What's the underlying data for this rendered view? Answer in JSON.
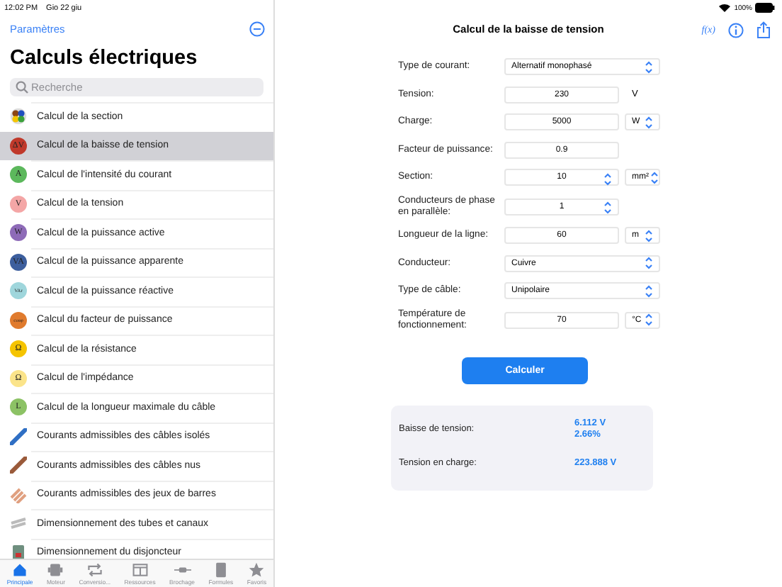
{
  "status_bar": {
    "time": "12:02 PM",
    "date": "Gio 22 giu",
    "battery_text": "100%"
  },
  "sidebar": {
    "back_link": "Paramètres",
    "title": "Calculs électriques",
    "search": {
      "placeholder": "Recherche"
    },
    "items": [
      {
        "label": "Calcul de la section",
        "kind": "pie",
        "selected": false
      },
      {
        "label": "Calcul de la baisse de tension",
        "kind": "circle",
        "glyph": "ΔV",
        "color": "#c0392b",
        "selected": true
      },
      {
        "label": "Calcul de l'intensité du courant",
        "kind": "circle",
        "glyph": "A",
        "color": "#5cb85c",
        "selected": false
      },
      {
        "label": "Calcul de la tension",
        "kind": "circle",
        "glyph": "V",
        "color": "#f4a6a6",
        "selected": false
      },
      {
        "label": "Calcul de la puissance active",
        "kind": "circle",
        "glyph": "W",
        "color": "#8e6bb8",
        "selected": false
      },
      {
        "label": "Calcul de la puissance apparente",
        "kind": "circle",
        "glyph": "VA",
        "color": "#3d5f9e",
        "selected": false
      },
      {
        "label": "Calcul de la puissance réactive",
        "kind": "circle",
        "glyph": "VAr",
        "color": "#9fd6dc",
        "selected": false
      },
      {
        "label": "Calcul du facteur de puissance",
        "kind": "circle",
        "glyph": "cosφ",
        "color": "#e07b2e",
        "selected": false
      },
      {
        "label": "Calcul de la résistance",
        "kind": "circle",
        "glyph": "Ω",
        "color": "#f5c400",
        "selected": false
      },
      {
        "label": "Calcul de l'impédance",
        "kind": "circle",
        "glyph": "Ω",
        "color": "#fbe48a",
        "selected": false
      },
      {
        "label": "Calcul de la longueur maximale du câble",
        "kind": "circle",
        "glyph": "L",
        "color": "#8cc265",
        "selected": false
      },
      {
        "label": "Courants admissibles des câbles isolés",
        "kind": "cable",
        "color": "#2f6fc4",
        "selected": false
      },
      {
        "label": "Courants admissibles des câbles nus",
        "kind": "cable",
        "color": "#9a5a3a",
        "selected": false
      },
      {
        "label": "Courants admissibles des jeux de barres",
        "kind": "bars",
        "color": "#e0a080",
        "selected": false
      },
      {
        "label": "Dimensionnement des tubes et canaux",
        "kind": "tube",
        "color": "#bbbbbb",
        "selected": false
      },
      {
        "label": "Dimensionnement du disjoncteur",
        "kind": "breaker",
        "color": "#6f8f7f",
        "selected": false
      }
    ]
  },
  "tab_bar": [
    {
      "label": "Principale",
      "kind": "house",
      "selected": true
    },
    {
      "label": "Moteur",
      "kind": "motor",
      "selected": false
    },
    {
      "label": "Conversio...",
      "kind": "arrows",
      "selected": false
    },
    {
      "label": "Ressources",
      "kind": "table",
      "selected": false
    },
    {
      "label": "Brochage",
      "kind": "plug",
      "selected": false
    },
    {
      "label": "Formules",
      "kind": "book",
      "selected": false
    },
    {
      "label": "Favoris",
      "kind": "star",
      "selected": false
    }
  ],
  "detail": {
    "title": "Calcul de la baisse de tension",
    "formula_button": "f(x)",
    "form": [
      {
        "label": "Type de courant:",
        "field": {
          "kind": "select",
          "value": "Alternatif monophasé"
        }
      },
      {
        "label": "Tension:",
        "field": {
          "kind": "input",
          "value": "230"
        },
        "unit": {
          "kind": "plain",
          "text": "V"
        }
      },
      {
        "label": "Charge:",
        "field": {
          "kind": "input",
          "value": "5000"
        },
        "unit": {
          "kind": "select",
          "text": "W"
        }
      },
      {
        "label": "Facteur de puissance:",
        "field": {
          "kind": "input",
          "value": "0.9"
        }
      },
      {
        "label": "Section:",
        "field": {
          "kind": "stepper",
          "value": "10"
        },
        "unit": {
          "kind": "select",
          "text": "mm²"
        }
      },
      {
        "label": "Conducteurs de phase en parallèle:",
        "field": {
          "kind": "stepper",
          "value": "1"
        }
      },
      {
        "label": "Longueur de la ligne:",
        "field": {
          "kind": "input",
          "value": "60"
        },
        "unit": {
          "kind": "select",
          "text": "m"
        }
      },
      {
        "label": "Conducteur:",
        "field": {
          "kind": "select",
          "value": "Cuivre"
        }
      },
      {
        "label": "Type de câble:",
        "field": {
          "kind": "select",
          "value": "Unipolaire"
        }
      },
      {
        "label": "Température de fonctionnement:",
        "field": {
          "kind": "input",
          "value": "70"
        },
        "unit": {
          "kind": "select",
          "text": "°C"
        }
      }
    ],
    "calculate_button": "Calculer",
    "results": [
      {
        "label": "Baisse de tension:",
        "values": [
          "6.112 V",
          "2.66%"
        ]
      },
      {
        "label": "Tension en charge:",
        "values": [
          "223.888 V"
        ]
      }
    ]
  }
}
